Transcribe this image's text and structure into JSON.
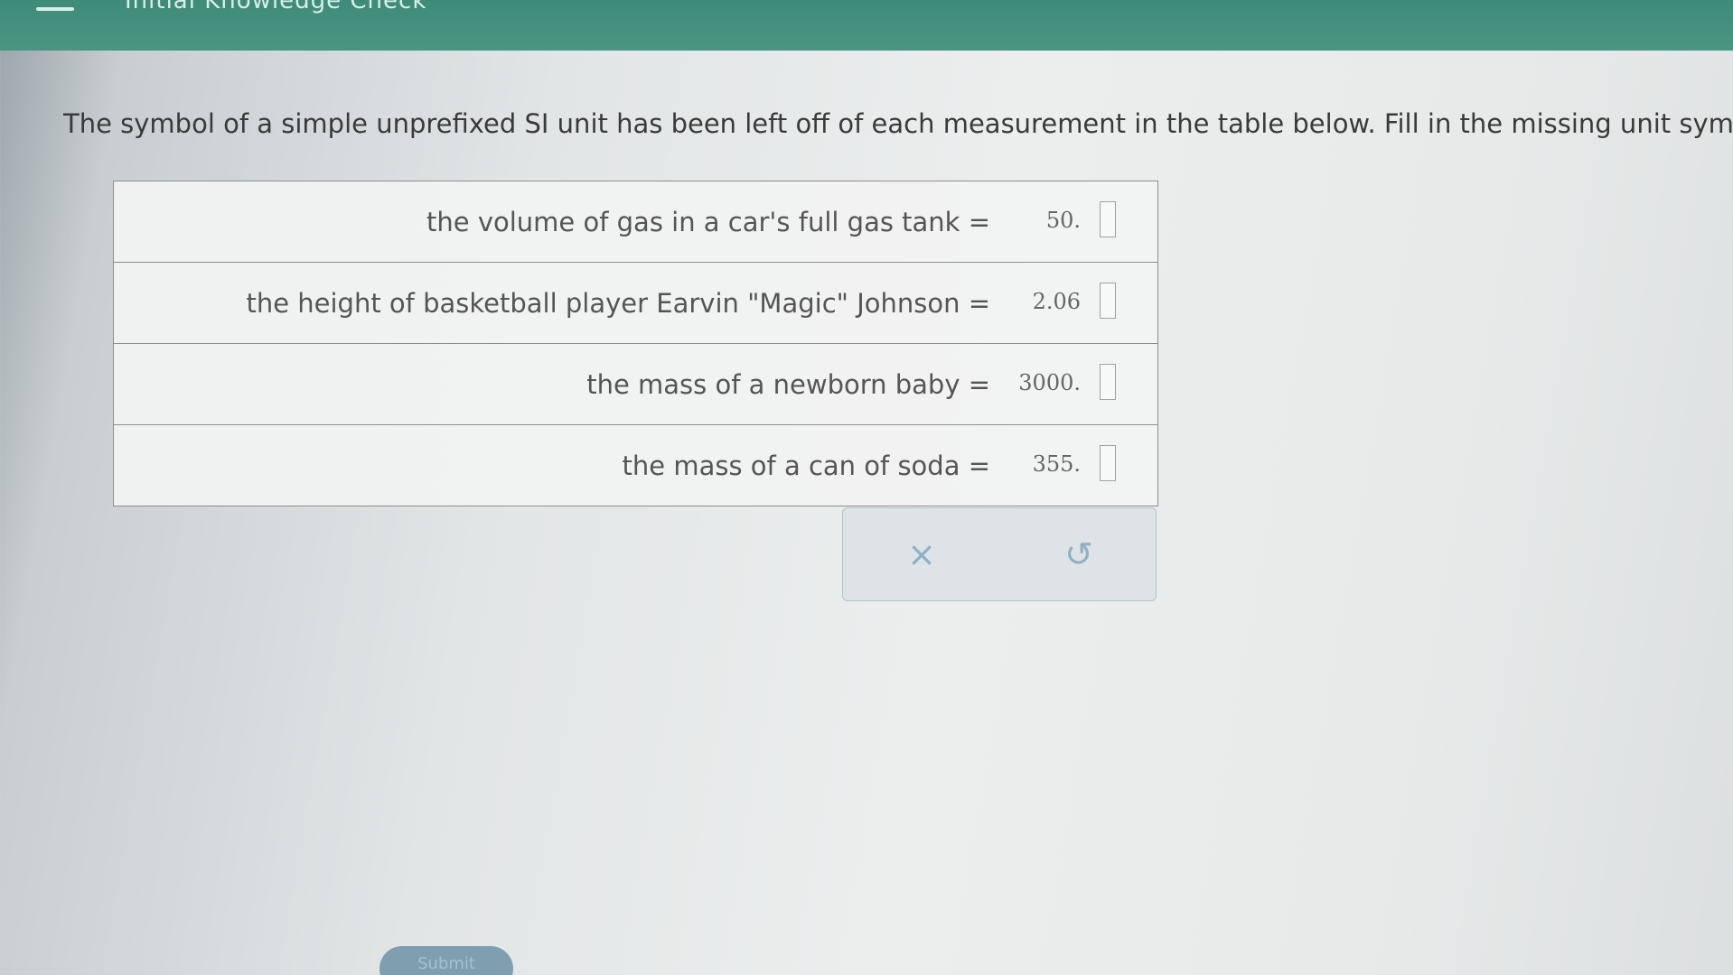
{
  "header": {
    "title": "Initial Knowledge Check"
  },
  "question": {
    "instructions": "The symbol of a simple unprefixed SI unit has been left off of each measurement in the table below. Fill in the missing unit symbols."
  },
  "measurements": [
    {
      "label": "the volume of gas in a car's full gas tank =",
      "value": "50.",
      "unit": ""
    },
    {
      "label": "the height of basketball player Earvin \"Magic\" Johnson =",
      "value": "2.06",
      "unit": ""
    },
    {
      "label": "the mass of a newborn baby =",
      "value": "3000.",
      "unit": ""
    },
    {
      "label": "the mass of a can of soda =",
      "value": "355.",
      "unit": ""
    }
  ],
  "actions": {
    "clear_symbol": "×",
    "undo_symbol": "↺"
  },
  "submit": {
    "label": "Submit"
  },
  "colors": {
    "header_green": "#4a9582",
    "action_icon": "#8fb1c2"
  }
}
